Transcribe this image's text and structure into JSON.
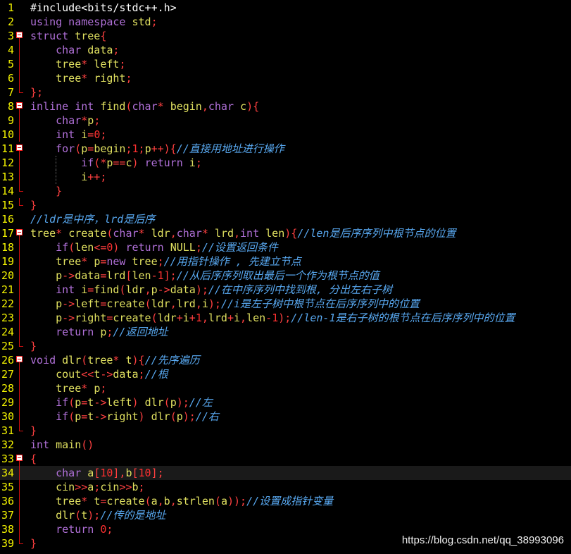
{
  "editor": {
    "colors": {
      "background": "#000000",
      "line_number": "#f2f200",
      "keyword": "#b070d8",
      "type": "#e0e060",
      "operator": "#ff4040",
      "number": "#ff3030",
      "comment": "#58a8f0",
      "fold_marker": "#d01010"
    },
    "current_line": 34,
    "fold_icon": "minus-box-icon",
    "lines": [
      {
        "n": "1",
        "segs": [
          [
            "pp",
            "#include<bits/stdc++.h>"
          ]
        ]
      },
      {
        "n": "2",
        "segs": [
          [
            "kw",
            "using namespace "
          ],
          [
            "ty",
            "std"
          ],
          [
            "op",
            ";"
          ]
        ]
      },
      {
        "n": "3",
        "segs": [
          [
            "kw",
            "struct "
          ],
          [
            "ty",
            "tree"
          ],
          [
            "op",
            "{"
          ]
        ]
      },
      {
        "n": "4",
        "segs": [
          [
            "",
            "    "
          ],
          [
            "kw",
            "char "
          ],
          [
            "ty",
            "data"
          ],
          [
            "op",
            ";"
          ]
        ]
      },
      {
        "n": "5",
        "segs": [
          [
            "",
            "    "
          ],
          [
            "ty",
            "tree"
          ],
          [
            "op",
            "* "
          ],
          [
            "ty",
            "left"
          ],
          [
            "op",
            ";"
          ]
        ]
      },
      {
        "n": "6",
        "segs": [
          [
            "",
            "    "
          ],
          [
            "ty",
            "tree"
          ],
          [
            "op",
            "* "
          ],
          [
            "ty",
            "right"
          ],
          [
            "op",
            ";"
          ]
        ]
      },
      {
        "n": "7",
        "segs": [
          [
            "op",
            "};"
          ]
        ]
      },
      {
        "n": "8",
        "segs": [
          [
            "kw",
            "inline int "
          ],
          [
            "ty",
            "find"
          ],
          [
            "op",
            "("
          ],
          [
            "kw",
            "char"
          ],
          [
            "op",
            "* "
          ],
          [
            "ty",
            "begin"
          ],
          [
            "op",
            ","
          ],
          [
            "kw",
            "char "
          ],
          [
            "ty",
            "c"
          ],
          [
            "op",
            "){"
          ]
        ]
      },
      {
        "n": "9",
        "segs": [
          [
            "",
            "    "
          ],
          [
            "kw",
            "char"
          ],
          [
            "op",
            "*"
          ],
          [
            "ty",
            "p"
          ],
          [
            "op",
            ";"
          ]
        ]
      },
      {
        "n": "10",
        "segs": [
          [
            "",
            "    "
          ],
          [
            "kw",
            "int "
          ],
          [
            "ty",
            "i"
          ],
          [
            "op",
            "="
          ],
          [
            "num",
            "0"
          ],
          [
            "op",
            ";"
          ]
        ]
      },
      {
        "n": "11",
        "segs": [
          [
            "",
            "    "
          ],
          [
            "kw",
            "for"
          ],
          [
            "op",
            "("
          ],
          [
            "ty",
            "p"
          ],
          [
            "op",
            "="
          ],
          [
            "ty",
            "begin"
          ],
          [
            "op",
            ";"
          ],
          [
            "num",
            "1"
          ],
          [
            "op",
            ";"
          ],
          [
            "ty",
            "p"
          ],
          [
            "op",
            "++){"
          ],
          [
            "cm",
            "//直接用地址进行操作"
          ]
        ]
      },
      {
        "n": "12",
        "segs": [
          [
            "",
            "        "
          ],
          [
            "kw",
            "if"
          ],
          [
            "op",
            "(*"
          ],
          [
            "ty",
            "p"
          ],
          [
            "op",
            "=="
          ],
          [
            "ty",
            "c"
          ],
          [
            "op",
            ") "
          ],
          [
            "kw",
            "return "
          ],
          [
            "ty",
            "i"
          ],
          [
            "op",
            ";"
          ]
        ]
      },
      {
        "n": "13",
        "segs": [
          [
            "",
            "        "
          ],
          [
            "ty",
            "i"
          ],
          [
            "op",
            "++;"
          ]
        ]
      },
      {
        "n": "14",
        "segs": [
          [
            "",
            "    "
          ],
          [
            "op",
            "}"
          ]
        ]
      },
      {
        "n": "15",
        "segs": [
          [
            "op",
            "}"
          ]
        ]
      },
      {
        "n": "16",
        "segs": [
          [
            "cm",
            "//ldr是中序，lrd是后序"
          ]
        ]
      },
      {
        "n": "17",
        "segs": [
          [
            "ty",
            "tree"
          ],
          [
            "op",
            "* "
          ],
          [
            "ty",
            "create"
          ],
          [
            "op",
            "("
          ],
          [
            "kw",
            "char"
          ],
          [
            "op",
            "* "
          ],
          [
            "ty",
            "ldr"
          ],
          [
            "op",
            ","
          ],
          [
            "kw",
            "char"
          ],
          [
            "op",
            "* "
          ],
          [
            "ty",
            "lrd"
          ],
          [
            "op",
            ","
          ],
          [
            "kw",
            "int "
          ],
          [
            "ty",
            "len"
          ],
          [
            "op",
            "){"
          ],
          [
            "cm",
            "//len是后序序列中根节点的位置"
          ]
        ]
      },
      {
        "n": "18",
        "segs": [
          [
            "",
            "    "
          ],
          [
            "kw",
            "if"
          ],
          [
            "op",
            "("
          ],
          [
            "ty",
            "len"
          ],
          [
            "op",
            "<="
          ],
          [
            "num",
            "0"
          ],
          [
            "op",
            ") "
          ],
          [
            "kw",
            "return "
          ],
          [
            "ty",
            "NULL"
          ],
          [
            "op",
            ";"
          ],
          [
            "cm",
            "//设置返回条件"
          ]
        ]
      },
      {
        "n": "19",
        "segs": [
          [
            "",
            "    "
          ],
          [
            "ty",
            "tree"
          ],
          [
            "op",
            "* "
          ],
          [
            "ty",
            "p"
          ],
          [
            "op",
            "="
          ],
          [
            "kw",
            "new "
          ],
          [
            "ty",
            "tree"
          ],
          [
            "op",
            ";"
          ],
          [
            "cm",
            "//用指针操作 , 先建立节点"
          ]
        ]
      },
      {
        "n": "20",
        "segs": [
          [
            "",
            "    "
          ],
          [
            "ty",
            "p"
          ],
          [
            "op",
            "->"
          ],
          [
            "ty",
            "data"
          ],
          [
            "op",
            "="
          ],
          [
            "ty",
            "lrd"
          ],
          [
            "op",
            "["
          ],
          [
            "ty",
            "len"
          ],
          [
            "op",
            "-"
          ],
          [
            "num",
            "1"
          ],
          [
            "op",
            "];"
          ],
          [
            "cm",
            "//从后序序列取出最后一个作为根节点的值"
          ]
        ]
      },
      {
        "n": "21",
        "segs": [
          [
            "",
            "    "
          ],
          [
            "kw",
            "int "
          ],
          [
            "ty",
            "i"
          ],
          [
            "op",
            "="
          ],
          [
            "ty",
            "find"
          ],
          [
            "op",
            "("
          ],
          [
            "ty",
            "ldr"
          ],
          [
            "op",
            ","
          ],
          [
            "ty",
            "p"
          ],
          [
            "op",
            "->"
          ],
          [
            "ty",
            "data"
          ],
          [
            "op",
            ");"
          ],
          [
            "cm",
            "//在中序序列中找到根, 分出左右子树"
          ]
        ]
      },
      {
        "n": "22",
        "segs": [
          [
            "",
            "    "
          ],
          [
            "ty",
            "p"
          ],
          [
            "op",
            "->"
          ],
          [
            "ty",
            "left"
          ],
          [
            "op",
            "="
          ],
          [
            "ty",
            "create"
          ],
          [
            "op",
            "("
          ],
          [
            "ty",
            "ldr"
          ],
          [
            "op",
            ","
          ],
          [
            "ty",
            "lrd"
          ],
          [
            "op",
            ","
          ],
          [
            "ty",
            "i"
          ],
          [
            "op",
            ");"
          ],
          [
            "cm",
            "//i是左子树中根节点在后序序列中的位置"
          ]
        ]
      },
      {
        "n": "23",
        "segs": [
          [
            "",
            "    "
          ],
          [
            "ty",
            "p"
          ],
          [
            "op",
            "->"
          ],
          [
            "ty",
            "right"
          ],
          [
            "op",
            "="
          ],
          [
            "ty",
            "create"
          ],
          [
            "op",
            "("
          ],
          [
            "ty",
            "ldr"
          ],
          [
            "op",
            "+"
          ],
          [
            "ty",
            "i"
          ],
          [
            "op",
            "+"
          ],
          [
            "num",
            "1"
          ],
          [
            "op",
            ","
          ],
          [
            "ty",
            "lrd"
          ],
          [
            "op",
            "+"
          ],
          [
            "ty",
            "i"
          ],
          [
            "op",
            ","
          ],
          [
            "ty",
            "len"
          ],
          [
            "op",
            "-"
          ],
          [
            "num",
            "1"
          ],
          [
            "op",
            ");"
          ],
          [
            "cm",
            "//len-1是右子树的根节点在后序序列中的位置"
          ]
        ]
      },
      {
        "n": "24",
        "segs": [
          [
            "",
            "    "
          ],
          [
            "kw",
            "return "
          ],
          [
            "ty",
            "p"
          ],
          [
            "op",
            ";"
          ],
          [
            "cm",
            "//返回地址"
          ]
        ]
      },
      {
        "n": "25",
        "segs": [
          [
            "op",
            "}"
          ]
        ]
      },
      {
        "n": "26",
        "segs": [
          [
            "kw",
            "void "
          ],
          [
            "ty",
            "dlr"
          ],
          [
            "op",
            "("
          ],
          [
            "ty",
            "tree"
          ],
          [
            "op",
            "* "
          ],
          [
            "ty",
            "t"
          ],
          [
            "op",
            "){"
          ],
          [
            "cm",
            "//先序遍历"
          ]
        ]
      },
      {
        "n": "27",
        "segs": [
          [
            "",
            "    "
          ],
          [
            "ty",
            "cout"
          ],
          [
            "op",
            "<<"
          ],
          [
            "ty",
            "t"
          ],
          [
            "op",
            "->"
          ],
          [
            "ty",
            "data"
          ],
          [
            "op",
            ";"
          ],
          [
            "cm",
            "//根"
          ]
        ]
      },
      {
        "n": "28",
        "segs": [
          [
            "",
            "    "
          ],
          [
            "ty",
            "tree"
          ],
          [
            "op",
            "* "
          ],
          [
            "ty",
            "p"
          ],
          [
            "op",
            ";"
          ]
        ]
      },
      {
        "n": "29",
        "segs": [
          [
            "",
            "    "
          ],
          [
            "kw",
            "if"
          ],
          [
            "op",
            "("
          ],
          [
            "ty",
            "p"
          ],
          [
            "op",
            "="
          ],
          [
            "ty",
            "t"
          ],
          [
            "op",
            "->"
          ],
          [
            "ty",
            "left"
          ],
          [
            "op",
            ") "
          ],
          [
            "ty",
            "dlr"
          ],
          [
            "op",
            "("
          ],
          [
            "ty",
            "p"
          ],
          [
            "op",
            ");"
          ],
          [
            "cm",
            "//左"
          ]
        ]
      },
      {
        "n": "30",
        "segs": [
          [
            "",
            "    "
          ],
          [
            "kw",
            "if"
          ],
          [
            "op",
            "("
          ],
          [
            "ty",
            "p"
          ],
          [
            "op",
            "="
          ],
          [
            "ty",
            "t"
          ],
          [
            "op",
            "->"
          ],
          [
            "ty",
            "right"
          ],
          [
            "op",
            ") "
          ],
          [
            "ty",
            "dlr"
          ],
          [
            "op",
            "("
          ],
          [
            "ty",
            "p"
          ],
          [
            "op",
            ");"
          ],
          [
            "cm",
            "//右"
          ]
        ]
      },
      {
        "n": "31",
        "segs": [
          [
            "op",
            "}"
          ]
        ]
      },
      {
        "n": "32",
        "segs": [
          [
            "kw",
            "int "
          ],
          [
            "ty",
            "main"
          ],
          [
            "op",
            "()"
          ]
        ]
      },
      {
        "n": "33",
        "segs": [
          [
            "op",
            "{"
          ]
        ]
      },
      {
        "n": "34",
        "segs": [
          [
            "",
            "    "
          ],
          [
            "kw",
            "char "
          ],
          [
            "ty",
            "a"
          ],
          [
            "op",
            "["
          ],
          [
            "num",
            "10"
          ],
          [
            "op",
            "],"
          ],
          [
            "ty",
            "b"
          ],
          [
            "op",
            "["
          ],
          [
            "num",
            "10"
          ],
          [
            "op",
            "];"
          ]
        ]
      },
      {
        "n": "35",
        "segs": [
          [
            "",
            "    "
          ],
          [
            "ty",
            "cin"
          ],
          [
            "op",
            ">>"
          ],
          [
            "ty",
            "a"
          ],
          [
            "op",
            ";"
          ],
          [
            "ty",
            "cin"
          ],
          [
            "op",
            ">>"
          ],
          [
            "ty",
            "b"
          ],
          [
            "op",
            ";"
          ]
        ]
      },
      {
        "n": "36",
        "segs": [
          [
            "",
            "    "
          ],
          [
            "ty",
            "tree"
          ],
          [
            "op",
            "* "
          ],
          [
            "ty",
            "t"
          ],
          [
            "op",
            "="
          ],
          [
            "ty",
            "create"
          ],
          [
            "op",
            "("
          ],
          [
            "ty",
            "a"
          ],
          [
            "op",
            ","
          ],
          [
            "ty",
            "b"
          ],
          [
            "op",
            ","
          ],
          [
            "ty",
            "strlen"
          ],
          [
            "op",
            "("
          ],
          [
            "ty",
            "a"
          ],
          [
            "op",
            "));"
          ],
          [
            "cm",
            "//设置成指针变量"
          ]
        ]
      },
      {
        "n": "37",
        "segs": [
          [
            "",
            "    "
          ],
          [
            "ty",
            "dlr"
          ],
          [
            "op",
            "("
          ],
          [
            "ty",
            "t"
          ],
          [
            "op",
            ");"
          ],
          [
            "cm",
            "//传的是地址"
          ]
        ]
      },
      {
        "n": "38",
        "segs": [
          [
            "",
            "    "
          ],
          [
            "kw",
            "return "
          ],
          [
            "num",
            "0"
          ],
          [
            "op",
            ";"
          ]
        ]
      },
      {
        "n": "39",
        "segs": [
          [
            "op",
            "}"
          ]
        ]
      }
    ]
  },
  "watermark": {
    "text": "https://blog.csdn.net/qq_38993096"
  }
}
